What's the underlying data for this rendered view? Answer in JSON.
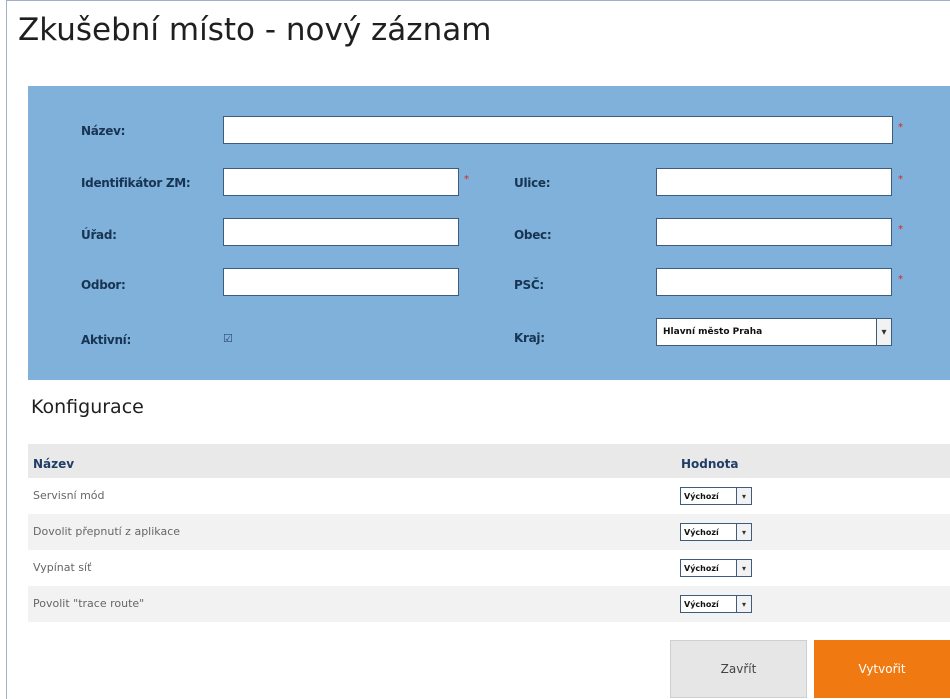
{
  "page": {
    "title": "Zkušební místo - nový záznam"
  },
  "form": {
    "nazev": {
      "label": "Název:",
      "value": ""
    },
    "identifikator": {
      "label": "Identifikátor ZM:",
      "value": ""
    },
    "urad": {
      "label": "Úřad:",
      "value": ""
    },
    "odbor": {
      "label": "Odbor:",
      "value": ""
    },
    "aktivni": {
      "label": "Aktivní:",
      "checked": true,
      "mark": "☑"
    },
    "ulice": {
      "label": "Ulice:",
      "value": ""
    },
    "obec": {
      "label": "Obec:",
      "value": ""
    },
    "psc": {
      "label": "PSČ:",
      "value": ""
    },
    "kraj": {
      "label": "Kraj:",
      "value": "Hlavní město Praha"
    },
    "required_mark": "*",
    "dropdown_arrow": "▾"
  },
  "config": {
    "title": "Konfigurace",
    "columns": {
      "name": "Název",
      "value": "Hodnota"
    },
    "rows": [
      {
        "name": "Servisní mód",
        "value": "Výchozí"
      },
      {
        "name": "Dovolit přepnutí z aplikace",
        "value": "Výchozí"
      },
      {
        "name": "Vypínat síť",
        "value": "Výchozí"
      },
      {
        "name": "Povolit \"trace route\"",
        "value": "Výchozí"
      }
    ]
  },
  "buttons": {
    "close": "Zavřít",
    "create": "Vytvořit"
  },
  "colors": {
    "panel": "#7fb1da",
    "accent": "#f07a11",
    "required": "#e02020"
  }
}
